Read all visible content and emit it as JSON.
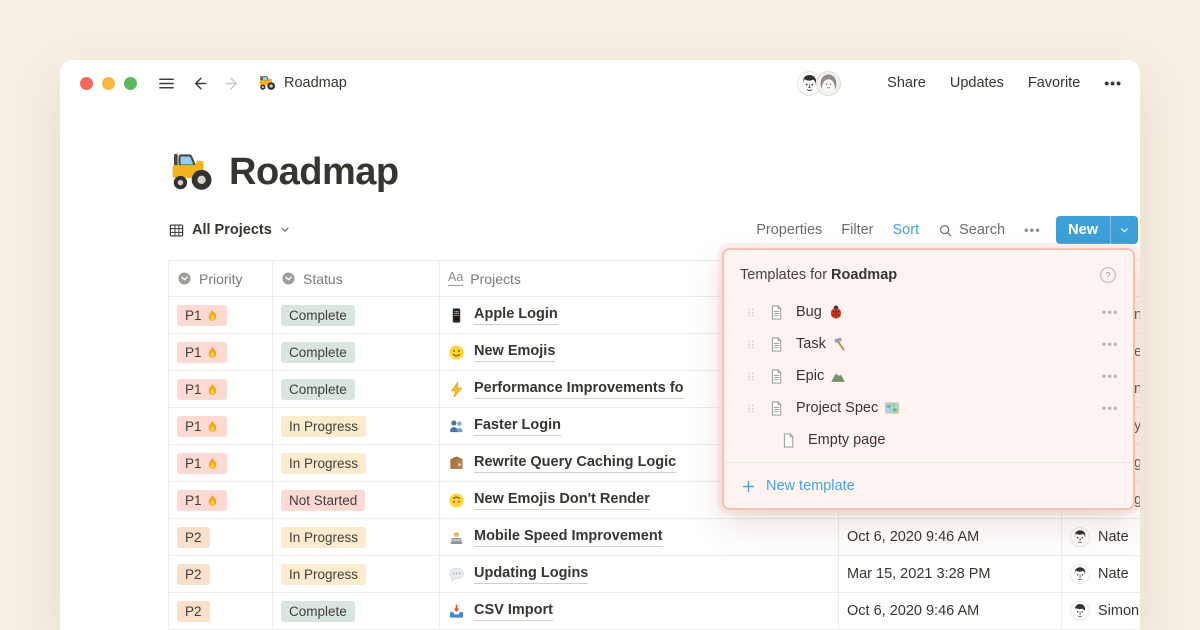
{
  "colors": {
    "desktop_background": "#f7efe4",
    "accent_blue": "#3da0d8",
    "link_blue": "#4a9fdd",
    "tag_red_bg": "#fcd9d2",
    "tag_orange_bg": "#fae0cb",
    "tag_yellow_bg": "#fbecce",
    "tag_green_bg": "#d9e6df",
    "popup_border": "#f6c0b3",
    "popup_bg": "#fdf4f1"
  },
  "topbar": {
    "doc_emoji": "🚜",
    "doc_title": "Roadmap",
    "actions": [
      "Share",
      "Updates",
      "Favorite"
    ],
    "more": "•••",
    "collaborators": [
      {
        "icon": "male-sketch-avatar"
      },
      {
        "icon": "female-sketch-avatar"
      }
    ]
  },
  "page": {
    "emoji": "🚜",
    "title": "Roadmap"
  },
  "toolbar": {
    "view_name": "All Projects",
    "properties": "Properties",
    "filter": "Filter",
    "sort": "Sort",
    "search": "Search",
    "more": "•••",
    "new_label": "New"
  },
  "table": {
    "headers": [
      {
        "label": "Priority",
        "icon": "select-property-icon"
      },
      {
        "label": "Status",
        "icon": "select-property-icon"
      },
      {
        "label": "Projects",
        "icon": "title-property-icon"
      }
    ],
    "rows": [
      {
        "priority": {
          "label": "P1",
          "emoji": "🔥",
          "icon": "fire",
          "color": "red"
        },
        "status": {
          "label": "Complete",
          "color": "green"
        },
        "project": {
          "emoji": "📱",
          "icon": "iphone",
          "title": "Apple Login"
        },
        "person_partial": "n Z"
      },
      {
        "priority": {
          "label": "P1",
          "emoji": "🔥",
          "icon": "fire",
          "color": "red"
        },
        "status": {
          "label": "Complete",
          "color": "green"
        },
        "project": {
          "emoji": "🙂",
          "icon": "smiley",
          "title": "New Emojis"
        },
        "person_partial": "e"
      },
      {
        "priority": {
          "label": "P1",
          "emoji": "🔥",
          "icon": "fire",
          "color": "red"
        },
        "status": {
          "label": "Complete",
          "color": "green"
        },
        "project": {
          "emoji": "⚡",
          "icon": "zap",
          "title": "Performance Improvements fo"
        },
        "person_partial": "ni"
      },
      {
        "priority": {
          "label": "P1",
          "emoji": "🔥",
          "icon": "fire",
          "color": "red"
        },
        "status": {
          "label": "In Progress",
          "color": "yellow"
        },
        "project": {
          "emoji": "👥",
          "icon": "busts",
          "title": "Faster Login"
        },
        "person_partial": "y"
      },
      {
        "priority": {
          "label": "P1",
          "emoji": "🔥",
          "icon": "fire",
          "color": "red"
        },
        "status": {
          "label": "In Progress",
          "color": "yellow"
        },
        "project": {
          "emoji": "📦",
          "icon": "package",
          "title": "Rewrite Query Caching Logic"
        },
        "person_partial": "ge"
      },
      {
        "priority": {
          "label": "P1",
          "emoji": "🔥",
          "icon": "fire",
          "color": "red"
        },
        "status": {
          "label": "Not Started",
          "color": "red"
        },
        "project": {
          "emoji": "🙃",
          "icon": "upside",
          "title": "New Emojis Don't Render"
        },
        "person_partial": "ge"
      },
      {
        "priority": {
          "label": "P2",
          "color": "orange"
        },
        "status": {
          "label": "In Progress",
          "color": "yellow"
        },
        "project": {
          "emoji": "👩‍💻",
          "icon": "tech",
          "title": "Mobile Speed Improvement"
        },
        "date": "Oct 6, 2020 9:46 AM",
        "person": {
          "name": "Nate",
          "icon": "male-sketch-avatar"
        }
      },
      {
        "priority": {
          "label": "P2",
          "color": "orange"
        },
        "status": {
          "label": "In Progress",
          "color": "yellow"
        },
        "project": {
          "emoji": "💬",
          "icon": "speech",
          "title": "Updating Logins"
        },
        "date": "Mar 15, 2021 3:28 PM",
        "person": {
          "name": "Nate",
          "icon": "male-sketch-avatar"
        }
      },
      {
        "priority": {
          "label": "P2",
          "color": "orange"
        },
        "status": {
          "label": "Complete",
          "color": "green"
        },
        "project": {
          "emoji": "📥",
          "icon": "inbox",
          "title": "CSV Import"
        },
        "date": "Oct 6, 2020 9:46 AM",
        "person": {
          "name": "Simon",
          "icon": "male2-sketch-avatar"
        }
      }
    ]
  },
  "popup": {
    "title_prefix": "Templates for",
    "title_doc": "Roadmap",
    "help_icon": "question-circle-icon",
    "items": [
      {
        "label": "Bug",
        "emoji": "🐞",
        "icon": "ladybug",
        "doc_icon": "template-doc",
        "draggable": true,
        "more": "•••"
      },
      {
        "label": "Task",
        "emoji": "🔨",
        "icon": "hammer",
        "doc_icon": "template-doc",
        "draggable": true,
        "more": "•••"
      },
      {
        "label": "Epic",
        "emoji": "⛰️",
        "icon": "mountain",
        "doc_icon": "template-doc",
        "draggable": true,
        "more": "•••"
      },
      {
        "label": "Project Spec",
        "emoji": "🗺️",
        "icon": "map",
        "doc_icon": "template-doc",
        "draggable": true,
        "more": "•••"
      },
      {
        "label": "Empty page",
        "icon": null,
        "doc_icon": "empty-page",
        "draggable": false
      }
    ],
    "new_template": "New template"
  }
}
